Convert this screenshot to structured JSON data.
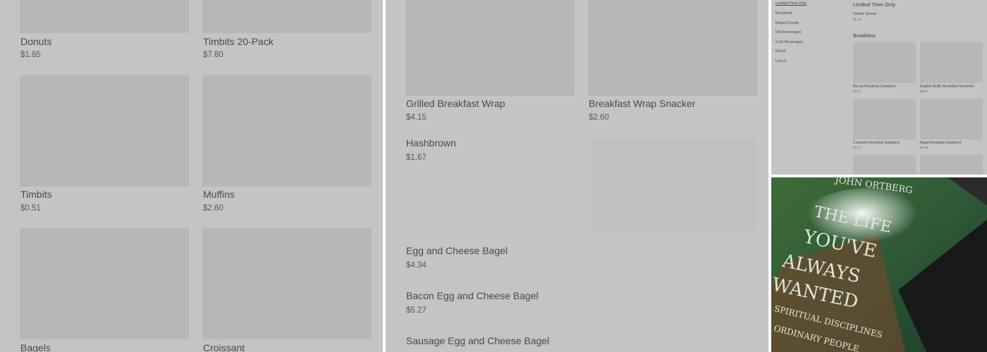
{
  "left_panel": {
    "items": [
      {
        "name": "Donuts",
        "price": "$1.85"
      },
      {
        "name": "Timbits 20-Pack",
        "price": "$7.80"
      },
      {
        "name": "Timbits",
        "price": "$0.51"
      },
      {
        "name": "Muffins",
        "price": "$2.60"
      },
      {
        "name": "Bagels",
        "price": ""
      },
      {
        "name": "Croissant",
        "price": ""
      }
    ]
  },
  "middle_panel": {
    "grid_items": [
      {
        "name": "Grilled Breakfast Wrap",
        "price": "$4.15"
      },
      {
        "name": "Breakfast Wrap Snacker",
        "price": "$2.60"
      }
    ],
    "list_items": [
      {
        "name": "Hashbrown",
        "price": "$1.67"
      },
      {
        "name": "Egg and Cheese Bagel",
        "price": "$4.34"
      },
      {
        "name": "Bacon Egg and Cheese Bagel",
        "price": "$5.27"
      },
      {
        "name": "Sausage Egg and Cheese Bagel",
        "price": ""
      }
    ]
  },
  "mini_panel": {
    "nav": [
      "Limited Time Only",
      "Breakfast",
      "Baked Goods",
      "Hot Beverages",
      "Cold Beverages",
      "Retail",
      "Lunch"
    ],
    "section_limited": "Limited Time Only",
    "limited_item": {
      "name": "Nutella Spread",
      "price": "$1.19"
    },
    "section_breakfast": "Breakfast",
    "breakfast_items": [
      {
        "name": "Biscuit Breakfast Sandwich",
        "price": "$4.11"
      },
      {
        "name": "English Muffin Breakfast Sandwich",
        "price": "$4.11"
      },
      {
        "name": "Croissant Breakfast Sandwich",
        "price": "$4.77"
      },
      {
        "name": "Bagel Breakfast Sandwich",
        "price": "$4.19"
      }
    ]
  },
  "book_photo": {
    "author": "JOHN ORTBERG",
    "title_lines": [
      "THE LIFE",
      "YOU'VE",
      "ALWAYS",
      "WANTED"
    ],
    "subtitle_lines": [
      "SPIRITUAL DISCIPLINES",
      "ORDINARY PEOPLE"
    ]
  }
}
